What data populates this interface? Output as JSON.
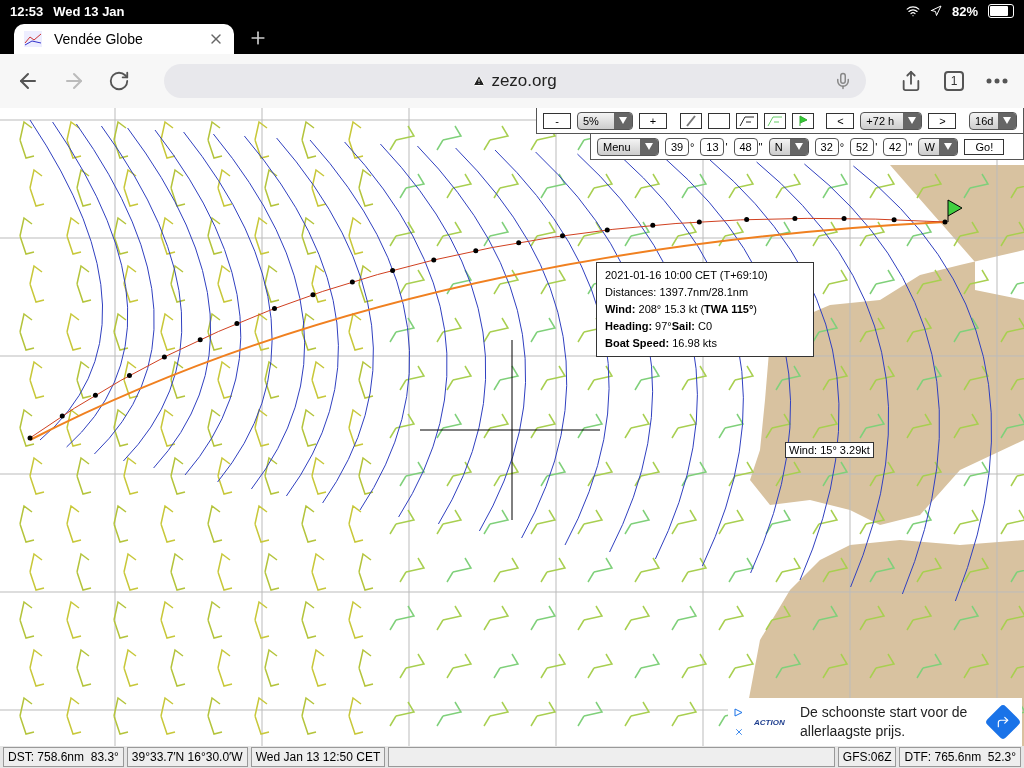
{
  "status_bar": {
    "time": "12:53",
    "date": "Wed 13 Jan",
    "battery": "82%",
    "battery_icon": {
      "level": 0.82
    }
  },
  "tabs": [
    {
      "title": "Vendée Globe",
      "selected": true
    }
  ],
  "nav": {
    "forward_disabled": true
  },
  "address_bar": {
    "url": "zezo.org"
  },
  "tab_count": "1",
  "map_toolbar": {
    "zoom_minus": "-",
    "zoom_value": "5%",
    "zoom_plus": "+",
    "prev": "<",
    "time_offset": "+72 h",
    "next": ">",
    "range": "16d",
    "menu": "Menu",
    "lat": [
      {
        "value": "39",
        "unit": "°"
      },
      {
        "value": "13",
        "unit": "'"
      },
      {
        "value": "48",
        "unit": "''"
      }
    ],
    "lat_hemisphere": "N",
    "lon": [
      {
        "value": "32",
        "unit": "°"
      },
      {
        "value": "52",
        "unit": "'"
      },
      {
        "value": "42",
        "unit": "''"
      }
    ],
    "lon_hemisphere": "W",
    "go": "Go!"
  },
  "tooltip": {
    "lines": [
      "2021-01-16 10:00 CET (T+69:10)",
      "Distances: 1397.7nm/28.1nm",
      "**Wind:** 208° 15.3 kt (**TWA 115°**)",
      "**Heading:** 97°**Sail:** C0",
      "**Boat Speed:** 16.98 kts"
    ]
  },
  "wind_label": "Wind: 15° 3.29kt",
  "ad": {
    "brand": "ACTION",
    "text": "De schoonste start voor de allerlaagste prijs."
  },
  "footer": {
    "left": [
      "DST: 758.6nm  83.3°",
      "39°33.7′N 16°30.0′W",
      "Wed Jan 13 12:50 CET"
    ],
    "right": [
      "GFS:06Z",
      "DTF: 765.6nm  52.3°"
    ]
  }
}
